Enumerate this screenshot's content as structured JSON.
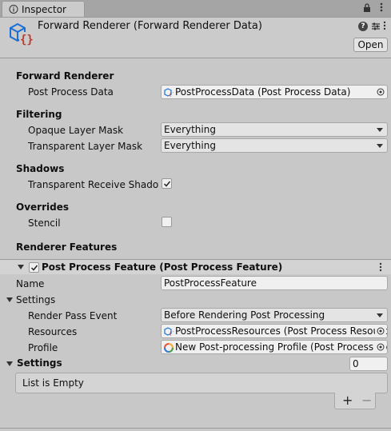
{
  "tab": {
    "label": "Inspector"
  },
  "header": {
    "title": "Forward Renderer (Forward Renderer Data)",
    "open_label": "Open"
  },
  "forward_renderer": {
    "heading": "Forward Renderer",
    "post_process_data_label": "Post Process Data",
    "post_process_data_value": "PostProcessData (Post Process Data)"
  },
  "filtering": {
    "heading": "Filtering",
    "opaque_label": "Opaque Layer Mask",
    "opaque_value": "Everything",
    "transparent_label": "Transparent Layer Mask",
    "transparent_value": "Everything"
  },
  "shadows": {
    "heading": "Shadows",
    "receive_label": "Transparent Receive Shadows",
    "receive_checked": true
  },
  "overrides": {
    "heading": "Overrides",
    "stencil_label": "Stencil",
    "stencil_checked": false
  },
  "renderer_features": {
    "heading": "Renderer Features",
    "feature_title": "Post Process Feature (Post Process Feature)",
    "feature_enabled": true,
    "name_label": "Name",
    "name_value": "PostProcessFeature",
    "settings_label": "Settings",
    "render_pass_label": "Render Pass Event",
    "render_pass_value": "Before Rendering Post Processing",
    "resources_label": "Resources",
    "resources_value": "PostProcessResources (Post Process Resources)",
    "profile_label": "Profile",
    "profile_value": "New Post-processing Profile (Post Process Profile)"
  },
  "settings_list": {
    "label": "Settings",
    "count": "0",
    "empty_text": "List is Empty",
    "add_symbol": "+",
    "remove_symbol": "−"
  },
  "colors": {
    "background": "#c8c8c8",
    "asset_icon": "#1a6fd6",
    "brace": "#c0392b"
  }
}
